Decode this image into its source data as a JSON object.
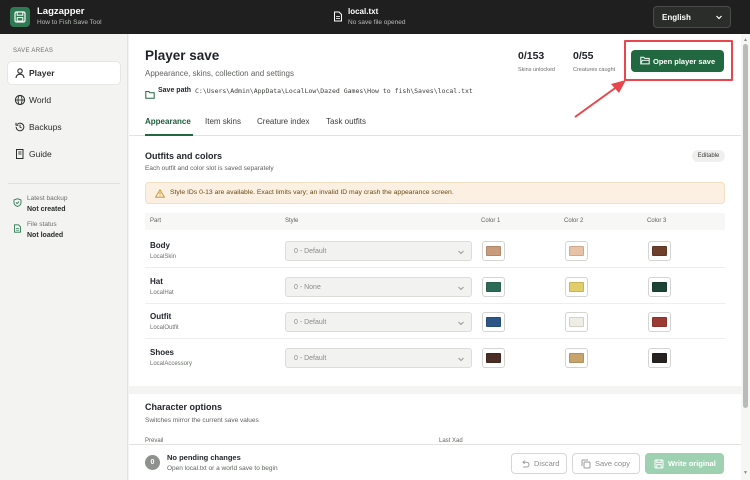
{
  "app": {
    "title": "Lagzapper",
    "subtitle": "How to Fish Save Tool"
  },
  "file": {
    "name": "local.txt",
    "status": "No save file opened"
  },
  "language": {
    "selected": "English"
  },
  "sidebar": {
    "heading": "SAVE AREAS",
    "items": [
      {
        "label": "Player",
        "icon": "user-icon",
        "active": true
      },
      {
        "label": "World",
        "icon": "globe-icon",
        "active": false
      },
      {
        "label": "Backups",
        "icon": "history-icon",
        "active": false
      },
      {
        "label": "Guide",
        "icon": "book-icon",
        "active": false
      }
    ],
    "meta": [
      {
        "label": "Latest backup",
        "value": "Not created",
        "icon": "shield-check-icon"
      },
      {
        "label": "File status",
        "value": "Not loaded",
        "icon": "file-icon"
      }
    ]
  },
  "header": {
    "title": "Player save",
    "subtitle": "Appearance, skins, collection and settings",
    "save_path_label": "Save path",
    "save_path": "C:\\Users\\Admin\\AppData\\LocalLow\\Dazed Games\\How to fish\\Saves\\local.txt",
    "stats": [
      {
        "value": "0/153",
        "label": "Skins unlocked"
      },
      {
        "value": "0/55",
        "label": "Creatures caught"
      }
    ],
    "open_button": "Open player save"
  },
  "tabs": [
    {
      "label": "Appearance",
      "active": true
    },
    {
      "label": "Item skins",
      "active": false
    },
    {
      "label": "Creature index",
      "active": false
    },
    {
      "label": "Task outfits",
      "active": false
    }
  ],
  "outfits": {
    "title": "Outfits and colors",
    "subtitle": "Each outfit and color slot is saved separately",
    "badge": "Editable",
    "warning": "Style IDs 0-13 are available. Exact limits vary; an invalid ID may crash the appearance screen.",
    "columns": [
      "Part",
      "Style",
      "Color 1",
      "Color 2",
      "Color 3"
    ],
    "rows": [
      {
        "part": "Body",
        "key": "LocalSkin",
        "style": "0 - Default",
        "colors": [
          "#c89b7b",
          "#e8c2a4",
          "#6e3f2b"
        ]
      },
      {
        "part": "Hat",
        "key": "LocalHat",
        "style": "0 - None",
        "colors": [
          "#2e6b57",
          "#e2cd6a",
          "#1d4436"
        ]
      },
      {
        "part": "Outfit",
        "key": "LocalOutfit",
        "style": "0 - Default",
        "colors": [
          "#2b5687",
          "#efeee6",
          "#9b3a33"
        ]
      },
      {
        "part": "Shoes",
        "key": "LocalAccessory",
        "style": "0 - Default",
        "colors": [
          "#4a2d25",
          "#c8a46c",
          "#262220"
        ]
      }
    ]
  },
  "character": {
    "title": "Character options",
    "subtitle": "Switches mirror the current save values",
    "cut_left": "Prevail",
    "cut_right": "Last Xad"
  },
  "footer": {
    "pending_count": "0",
    "pending_title": "No pending changes",
    "pending_sub": "Open local.txt or a world save to begin",
    "discard": "Discard",
    "save_copy": "Save copy",
    "write": "Write original"
  }
}
